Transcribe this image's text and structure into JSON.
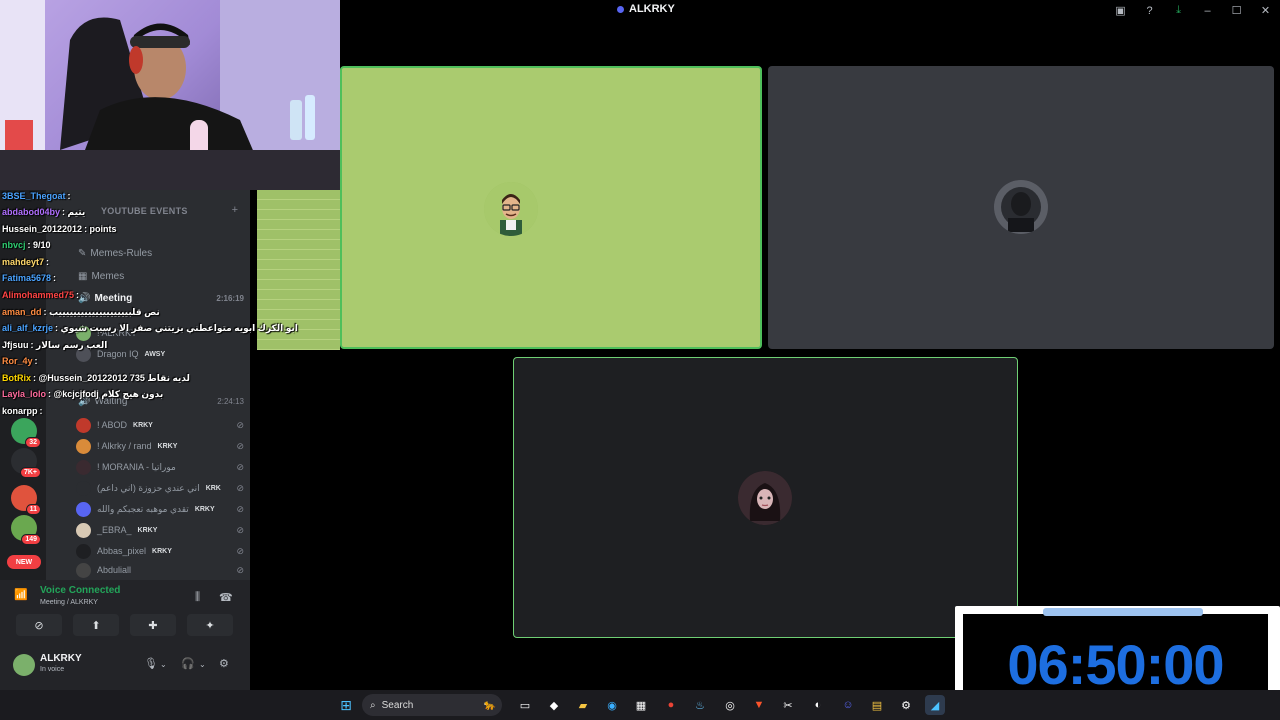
{
  "window": {
    "title": "ALKRKY"
  },
  "titlebar_icons": [
    "screen-share-icon",
    "help-icon",
    "download-icon",
    "minimize-icon",
    "maximize-icon",
    "close-icon"
  ],
  "channels": {
    "section": "YOUTUBE EVENTS",
    "items": [
      {
        "name": "Memes-Rules",
        "icon": "rules-icon"
      },
      {
        "name": "Memes",
        "icon": "image-icon"
      },
      {
        "name": "Meeting",
        "icon": "voice-icon",
        "time": "2:16:19"
      },
      {
        "name": "Waiting",
        "icon": "voice-icon",
        "time": "2:24:13"
      }
    ],
    "members": [
      {
        "name": "! ALKRKY",
        "tag": "KRKY"
      },
      {
        "name": "Dragon IQ",
        "tag": "AWSY"
      },
      {
        "name": "! ABOD",
        "tag": "KRKY"
      },
      {
        "name": "! Alkrky / rand",
        "tag": "KRKY"
      },
      {
        "name": "! MORANIA - موراتيا",
        "tag": ""
      },
      {
        "name": "(اني عندي حزوزة (اني داعم",
        "tag": "KRK"
      },
      {
        "name": "تقدي موهبه تعجبكم والله",
        "tag": "KRKY"
      },
      {
        "name": "_EBRA_",
        "tag": "KRKY"
      },
      {
        "name": "Abbas_pixel",
        "tag": "KRKY"
      },
      {
        "name": "Abduliall",
        "tag": ""
      }
    ]
  },
  "guild_badges": [
    "32",
    "7K+",
    "11",
    "149"
  ],
  "new_label": "NEW",
  "chat": [
    {
      "user": "3BSE_Thegoat",
      "msg": ":",
      "color": "#4aa3ff"
    },
    {
      "user": "abdabod04by",
      "msg": ": يتيم",
      "color": "#b06fff"
    },
    {
      "user": "Hussein_20122012",
      "msg": ": points",
      "color": "#ffffff"
    },
    {
      "user": "nbvcj",
      "msg": ": 9/10",
      "color": "#2ecc71"
    },
    {
      "user": "mahdeyt7",
      "msg": ":",
      "color": "#ffd86b"
    },
    {
      "user": "Fatima5678",
      "msg": ":",
      "color": "#4aa3ff"
    },
    {
      "user": "Alimohammed75",
      "msg": ":",
      "color": "#ff4444"
    },
    {
      "user": "aman_dd",
      "msg": ": نص قلبيييييييييييييييييييب",
      "color": "#ff8c42"
    },
    {
      "user": "ali_alf_kzrje",
      "msg": ": ابو الكرك ابويه متواعطني بزيتني صفر الا رسيت شيوي",
      "color": "#4aa3ff"
    },
    {
      "user": "Jfjsuu",
      "msg": ": العب رسم سالار",
      "color": "#ffffff"
    },
    {
      "user": "Ror_4y",
      "msg": ":",
      "color": "#ff8c42"
    },
    {
      "user": "BotRix",
      "msg": ": @Hussein_20122012 735 لديه نقاط",
      "color": "#ffd700"
    },
    {
      "user": "Layla_lolo",
      "msg": ": @kcjcjfodj بدون هيج كلام",
      "color": "#ff6b9d"
    },
    {
      "user": "konarpp",
      "msg": ":",
      "color": "#ffffff"
    }
  ],
  "voice": {
    "status": "Voice Connected",
    "location": "Meeting / ALKRKY"
  },
  "user": {
    "name": "ALKRKY",
    "status": "In voice"
  },
  "timer": {
    "value": "06:50:00"
  },
  "taskbar": {
    "search_placeholder": "Search"
  }
}
